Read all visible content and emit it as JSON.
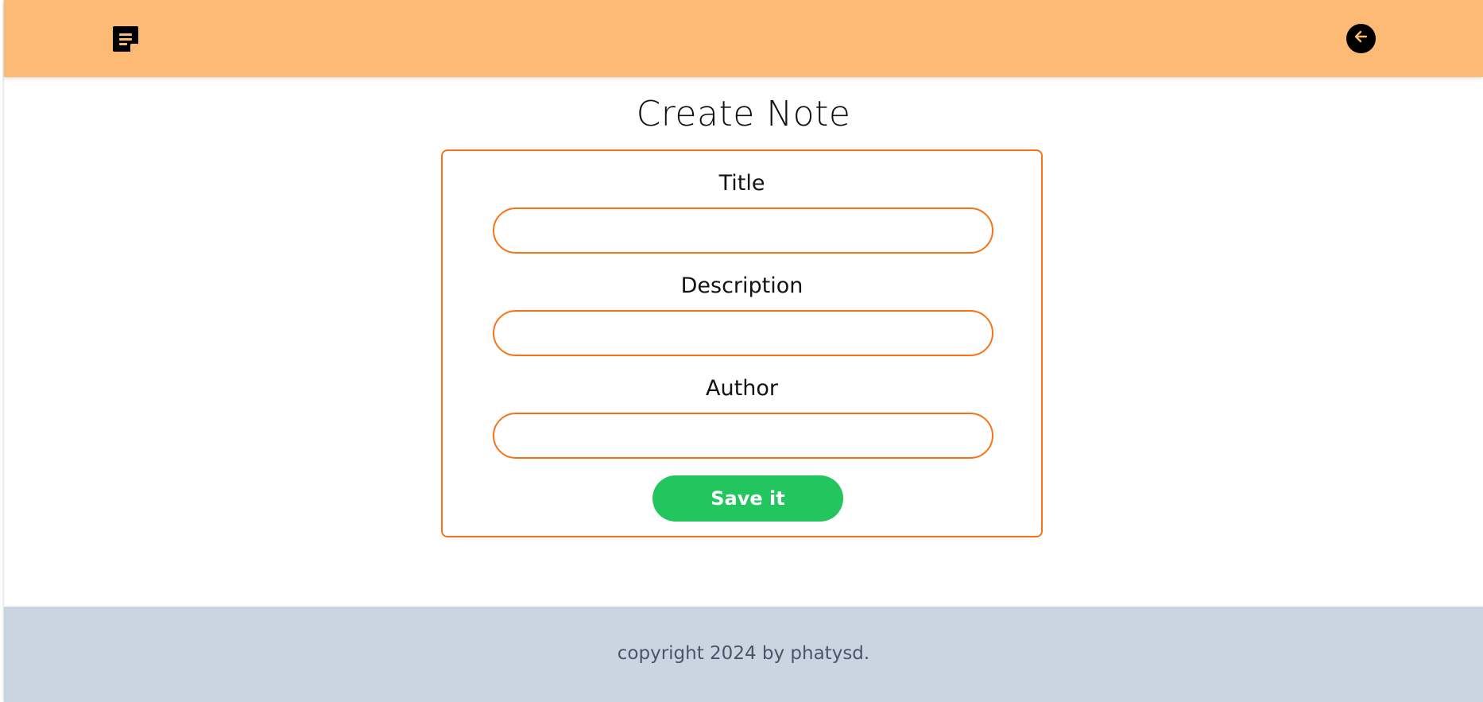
{
  "header": {
    "logo_icon": "note-icon",
    "back_icon": "arrow-left-icon",
    "background_color": "#fdba74"
  },
  "main": {
    "title": "Create Note",
    "form": {
      "fields": [
        {
          "label": "Title",
          "value": "",
          "placeholder": ""
        },
        {
          "label": "Description",
          "value": "",
          "placeholder": ""
        },
        {
          "label": "Author",
          "value": "",
          "placeholder": ""
        }
      ],
      "submit_label": "Save it",
      "border_color": "#f97316",
      "submit_color": "#22c55e"
    }
  },
  "footer": {
    "text": "copyright 2024 by phatysd.",
    "background_color": "#cbd5e1"
  }
}
